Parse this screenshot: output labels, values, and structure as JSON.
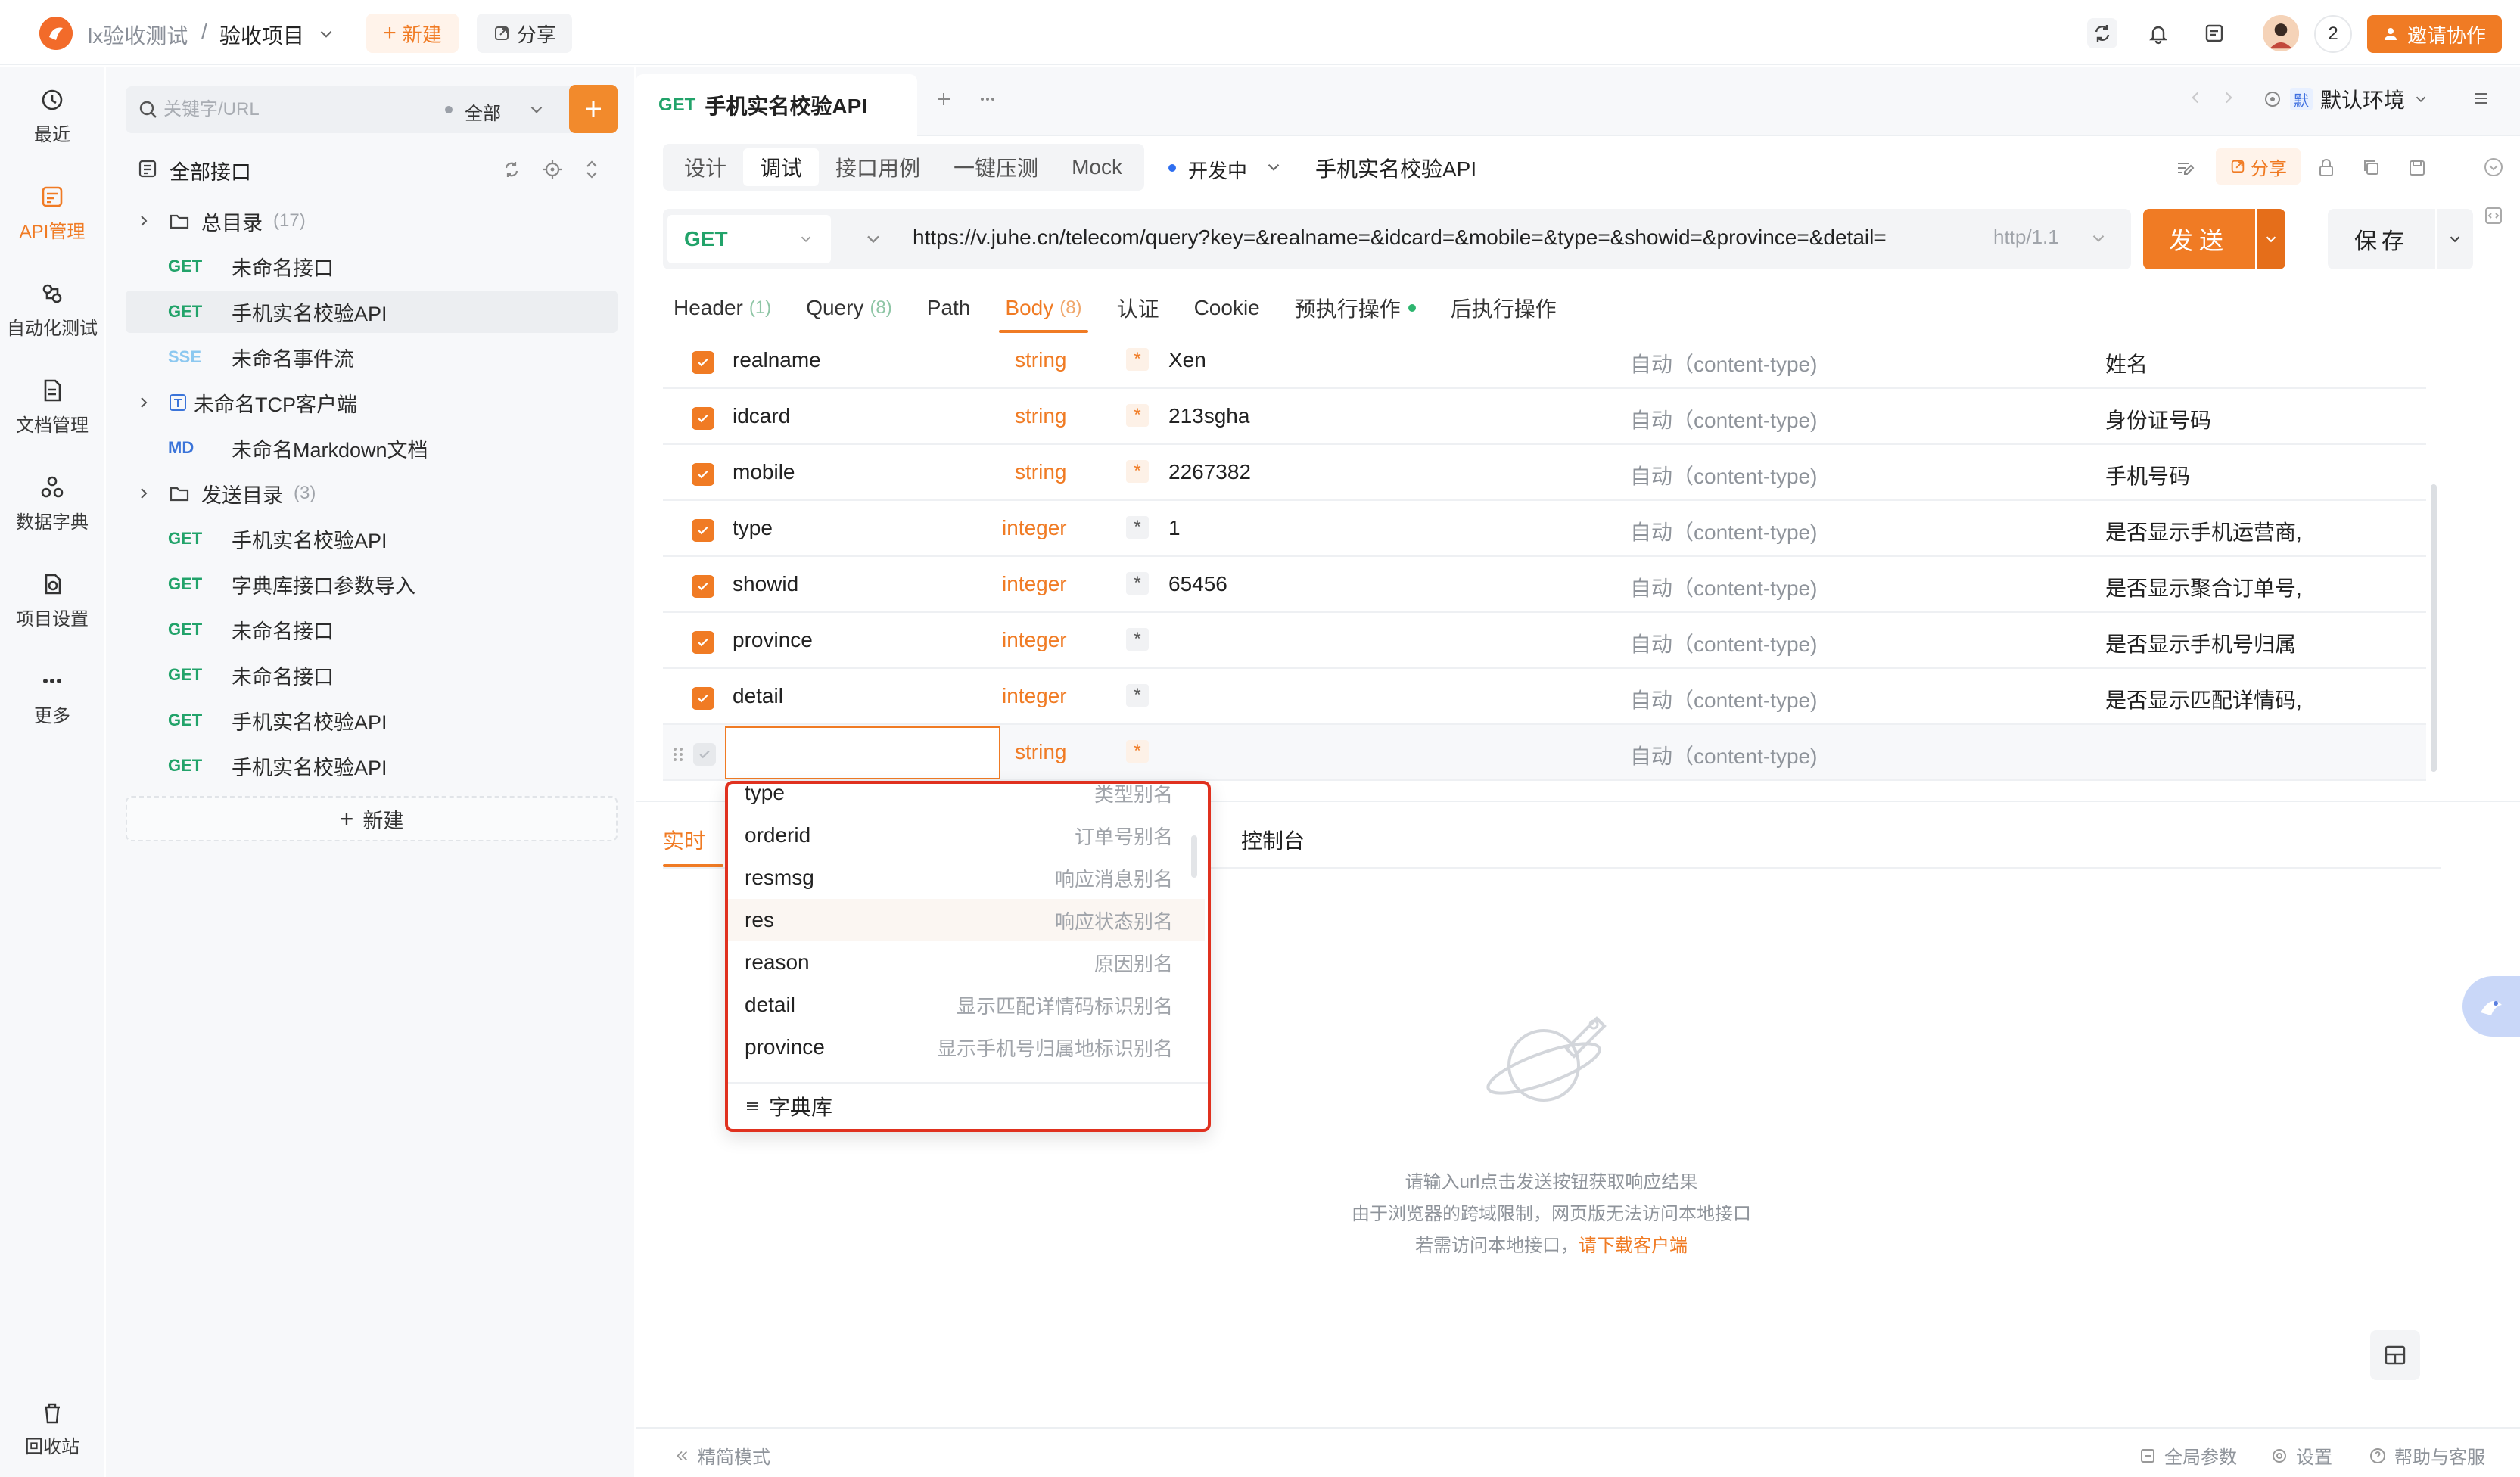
{
  "header": {
    "team": "lx验收测试",
    "separator": "/",
    "project": "验收项目",
    "new_label": "新建",
    "share_label": "分享",
    "user_count": "2",
    "invite_label": "邀请协作"
  },
  "rail": {
    "items": [
      {
        "label": "最近",
        "icon": "clock-icon"
      },
      {
        "label": "API管理",
        "icon": "api-icon"
      },
      {
        "label": "自动化测试",
        "icon": "automation-icon"
      },
      {
        "label": "文档管理",
        "icon": "document-icon"
      },
      {
        "label": "数据字典",
        "icon": "dictionary-icon"
      },
      {
        "label": "项目设置",
        "icon": "settings-icon"
      },
      {
        "label": "更多",
        "icon": "more-icon"
      }
    ],
    "trash": "回收站"
  },
  "tree": {
    "search_placeholder": "关键字/URL",
    "scope": "全部",
    "all_label": "全部接口",
    "items": [
      {
        "type": "folder",
        "label": "总目录",
        "count": "(17)"
      },
      {
        "type": "api",
        "method": "GET",
        "label": "未命名接口"
      },
      {
        "type": "api",
        "method": "GET",
        "label": "手机实名校验API"
      },
      {
        "type": "api",
        "method": "SSE",
        "label": "未命名事件流"
      },
      {
        "type": "tcp",
        "label": "未命名TCP客户端"
      },
      {
        "type": "api",
        "method": "MD",
        "label": "未命名Markdown文档"
      },
      {
        "type": "folder",
        "label": "发送目录",
        "count": "(3)"
      },
      {
        "type": "api",
        "method": "GET",
        "label": "手机实名校验API"
      },
      {
        "type": "api",
        "method": "GET",
        "label": "字典库接口参数导入"
      },
      {
        "type": "api",
        "method": "GET",
        "label": "未命名接口"
      },
      {
        "type": "api",
        "method": "GET",
        "label": "未命名接口"
      },
      {
        "type": "api",
        "method": "GET",
        "label": "手机实名校验API"
      },
      {
        "type": "api",
        "method": "GET",
        "label": "手机实名校验API"
      }
    ],
    "new_label": "新建"
  },
  "tab": {
    "method": "GET",
    "title": "手机实名校验API",
    "env_badge": "默",
    "env_label": "默认环境"
  },
  "subtabs": [
    "设计",
    "调试",
    "接口用例",
    "一键压测",
    "Mock"
  ],
  "status": "开发中",
  "api_name": "手机实名校验API",
  "share2_label": "分享",
  "request": {
    "method": "GET",
    "url": "https://v.juhe.cn/telecom/query?key=&realname=&idcard=&mobile=&type=&showid=&province=&detail=",
    "protocol": "http/1.1",
    "send_label": "发送",
    "save_label": "保存"
  },
  "param_tabs": [
    {
      "label": "Header",
      "count": "(1)"
    },
    {
      "label": "Query",
      "count": "(8)"
    },
    {
      "label": "Path",
      "count": ""
    },
    {
      "label": "Body",
      "count": "(8)"
    },
    {
      "label": "认证",
      "count": ""
    },
    {
      "label": "Cookie",
      "count": ""
    },
    {
      "label": "预执行操作",
      "count": ""
    },
    {
      "label": "后执行操作",
      "count": ""
    }
  ],
  "params": [
    {
      "name": "realname",
      "type": "string",
      "value": "Xen",
      "content_type": "自动（content-type)",
      "desc": "姓名"
    },
    {
      "name": "idcard",
      "type": "string",
      "value": "213sgha",
      "content_type": "自动（content-type)",
      "desc": "身份证号码"
    },
    {
      "name": "mobile",
      "type": "string",
      "value": "2267382",
      "content_type": "自动（content-type)",
      "desc": "手机号码"
    },
    {
      "name": "type",
      "type": "integer",
      "value": "1",
      "content_type": "自动（content-type)",
      "desc": "是否显示手机运营商,"
    },
    {
      "name": "showid",
      "type": "integer",
      "value": "65456",
      "content_type": "自动（content-type)",
      "desc": "是否显示聚合订单号,"
    },
    {
      "name": "province",
      "type": "integer",
      "value": "",
      "content_type": "自动（content-type)",
      "desc": "是否显示手机号归属"
    },
    {
      "name": "detail",
      "type": "integer",
      "value": "",
      "content_type": "自动（content-type)",
      "desc": "是否显示匹配详情码,"
    },
    {
      "name": "",
      "type": "string",
      "value": "",
      "content_type": "自动（content-type)",
      "desc": ""
    }
  ],
  "required_mark": "*",
  "response": {
    "tab1": "实时",
    "console": "控制台",
    "hint1": "请输入url点击发送按钮获取响应结果",
    "hint2": "由于浏览器的跨域限制，网页版无法访问本地接口",
    "hint3_prefix": "若需访问本地接口，",
    "hint3_link": "请下载客户端"
  },
  "dropdown": {
    "items": [
      {
        "name": "type",
        "alias": "类型别名"
      },
      {
        "name": "orderid",
        "alias": "订单号别名"
      },
      {
        "name": "resmsg",
        "alias": "响应消息别名"
      },
      {
        "name": "res",
        "alias": "响应状态别名"
      },
      {
        "name": "reason",
        "alias": "原因别名"
      },
      {
        "name": "detail",
        "alias": "显示匹配详情码标识别名"
      },
      {
        "name": "province",
        "alias": "显示手机号归属地标识别名"
      }
    ],
    "footer": "字典库"
  },
  "footer": {
    "compact": "精简模式",
    "global_params": "全局参数",
    "settings": "设置",
    "help": "帮助与客服"
  },
  "colors": {
    "accent": "#f07b24",
    "get": "#22a36a",
    "highlight_border": "#e0311f"
  }
}
